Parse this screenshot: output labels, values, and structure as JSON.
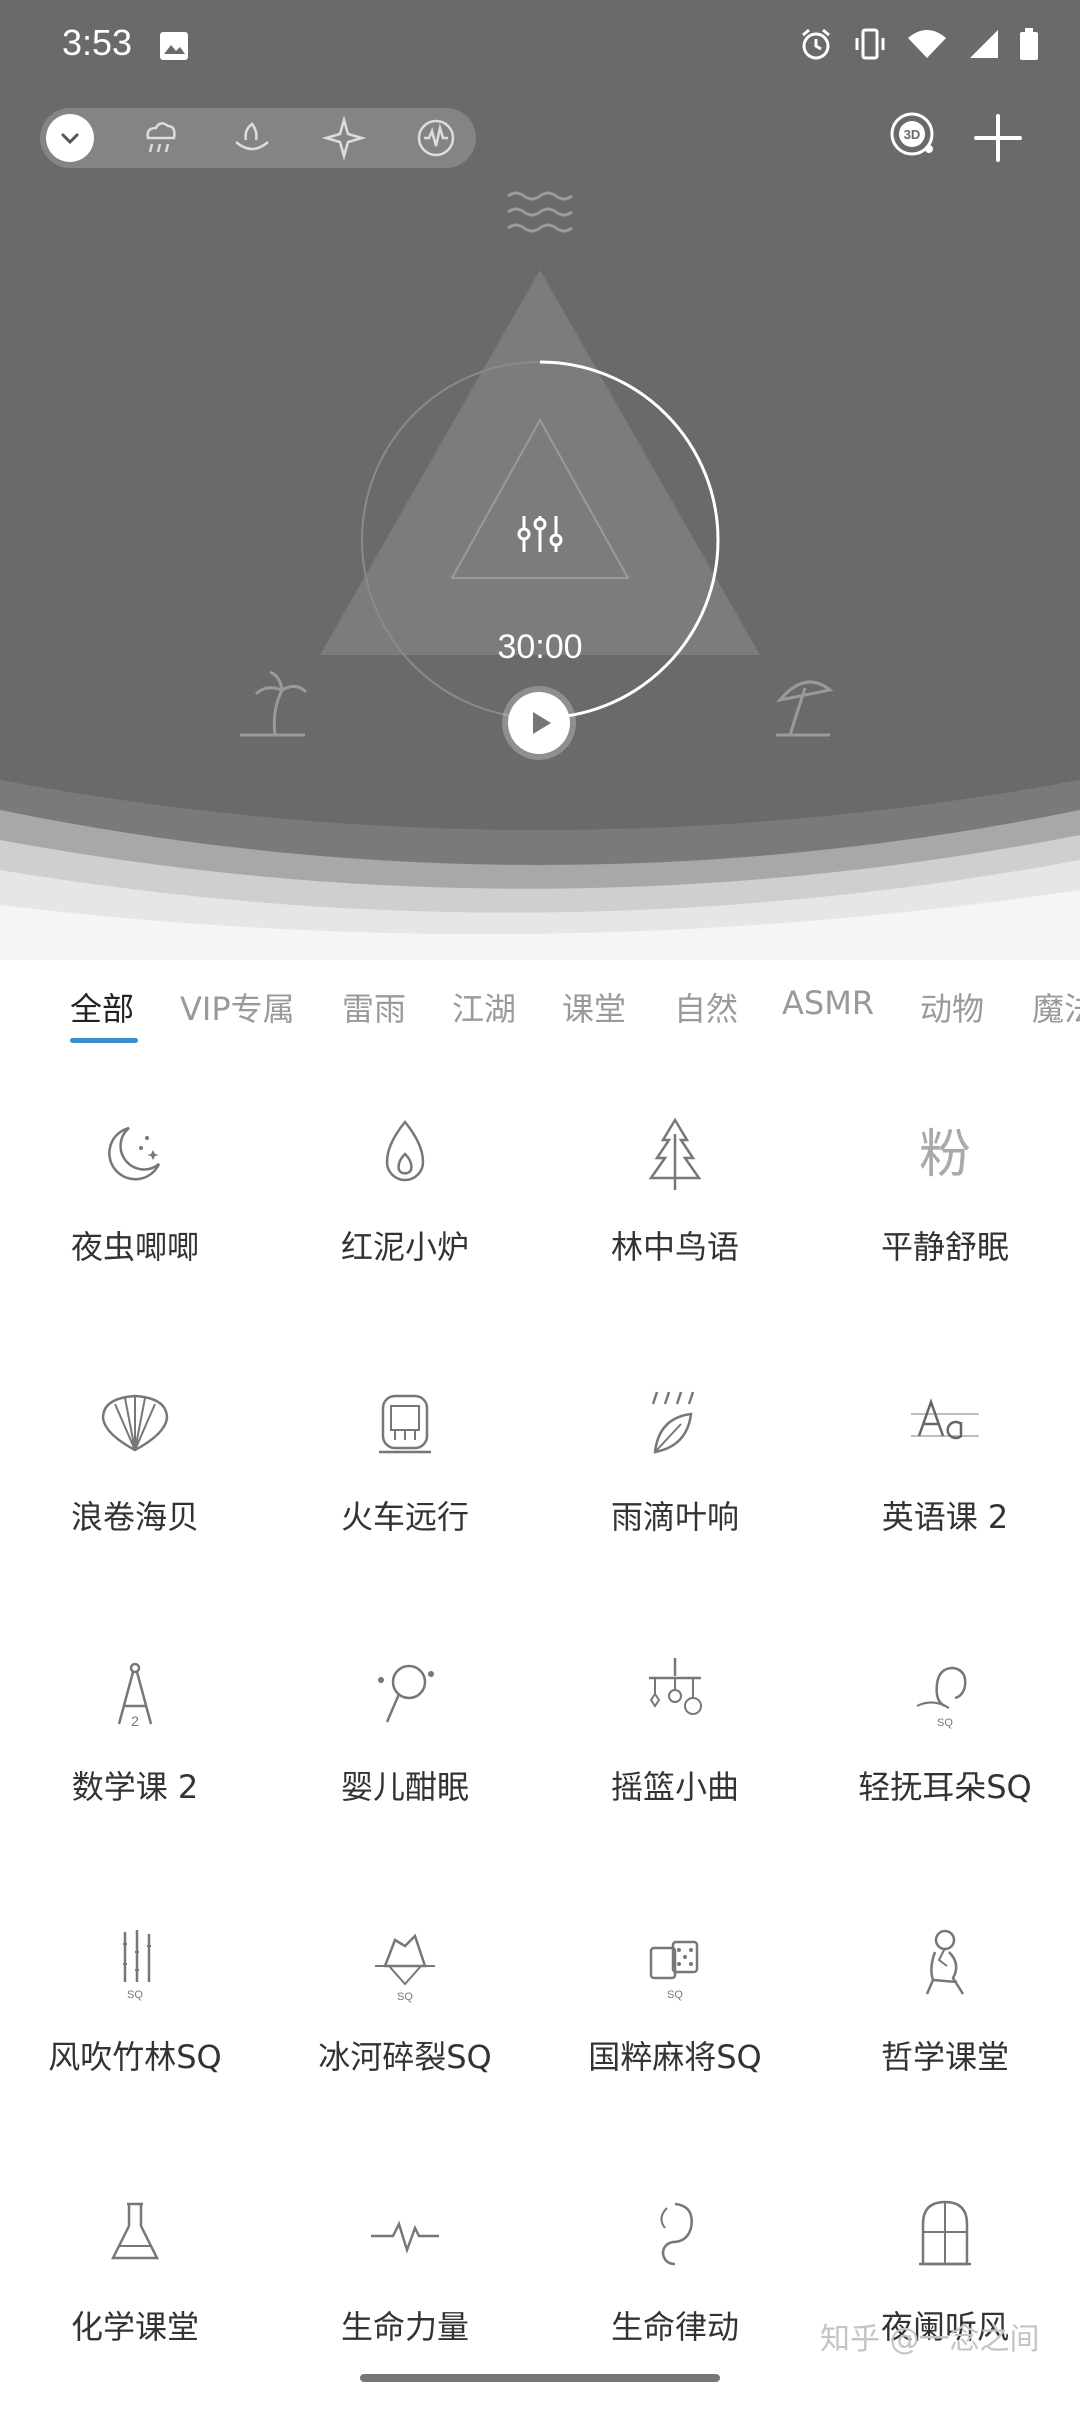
{
  "status_bar": {
    "time": "3:53"
  },
  "hero": {
    "timer": "30:00",
    "mode_icons": [
      "collapse-icon",
      "rain-icon",
      "campfire-icon",
      "sparkle-icon",
      "waveform-icon"
    ],
    "right_icons": [
      "3d-icon",
      "add-icon"
    ]
  },
  "tabs": [
    "全部",
    "VIP专属",
    "雷雨",
    "江湖",
    "课堂",
    "自然",
    "ASMR",
    "动物",
    "魔法"
  ],
  "active_tab": "全部",
  "sounds": [
    {
      "label": "夜虫唧唧",
      "icon": "moon-stars-icon"
    },
    {
      "label": "红泥小炉",
      "icon": "flame-icon"
    },
    {
      "label": "林中鸟语",
      "icon": "pine-tree-icon"
    },
    {
      "label": "平静舒眠",
      "icon": "powder-glyph-icon",
      "glyph": "粉"
    },
    {
      "label": "浪卷海贝",
      "icon": "seashell-icon"
    },
    {
      "label": "火车远行",
      "icon": "train-icon"
    },
    {
      "label": "雨滴叶响",
      "icon": "rain-leaf-icon"
    },
    {
      "label": "英语课 2",
      "icon": "letters-aa-icon"
    },
    {
      "label": "数学课 2",
      "icon": "compass-icon"
    },
    {
      "label": "婴儿酣眠",
      "icon": "rattle-icon"
    },
    {
      "label": "摇篮小曲",
      "icon": "mobile-toy-icon"
    },
    {
      "label": "轻抚耳朵SQ",
      "icon": "ear-icon"
    },
    {
      "label": "风吹竹林SQ",
      "icon": "bamboo-icon"
    },
    {
      "label": "冰河碎裂SQ",
      "icon": "iceberg-icon"
    },
    {
      "label": "国粹麻将SQ",
      "icon": "mahjong-icon"
    },
    {
      "label": "哲学课堂",
      "icon": "thinker-icon"
    },
    {
      "label": "化学课堂",
      "icon": "flask-icon"
    },
    {
      "label": "生命力量",
      "icon": "heartbeat-icon"
    },
    {
      "label": "生命律动",
      "icon": "embryo-icon"
    },
    {
      "label": "夜阑听风",
      "icon": "window-icon"
    }
  ],
  "watermark": "知乎 @一念之间"
}
